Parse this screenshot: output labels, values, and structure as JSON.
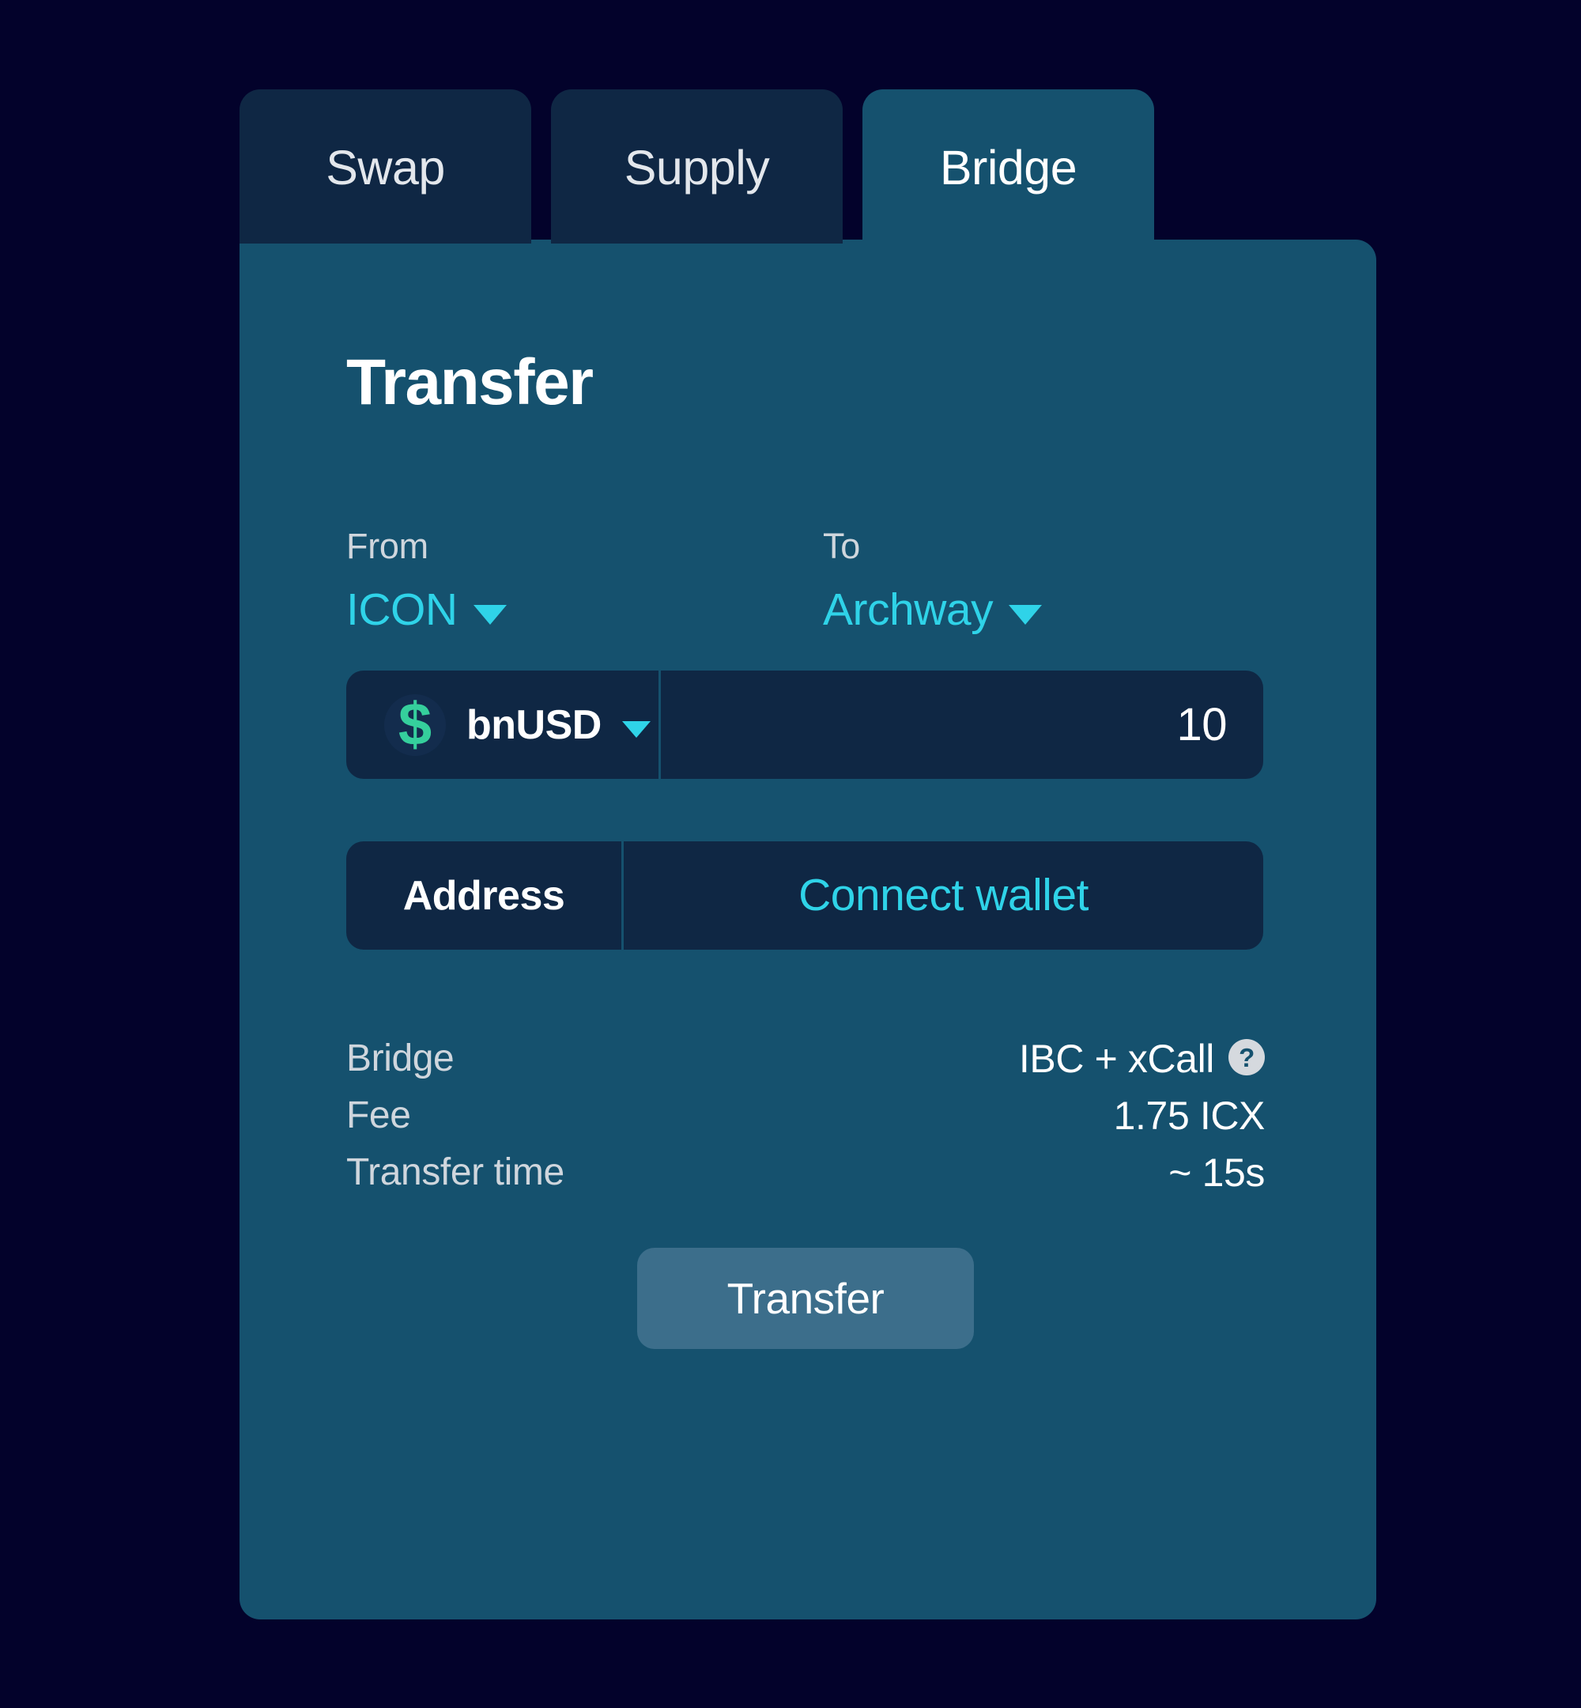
{
  "theme": {
    "page_background": "#03022b",
    "panel_background": "#15516e",
    "tab_inactive_background": "#0f2744",
    "field_background": "#0f2744",
    "accent_cyan": "#2fd3e8",
    "token_green": "#35cf9c",
    "cta_background": "#3c6e8b",
    "muted_text": "#cfd6dd"
  },
  "tabs": [
    {
      "label": "Swap",
      "active": false
    },
    {
      "label": "Supply",
      "active": false
    },
    {
      "label": "Bridge",
      "active": true
    }
  ],
  "panel": {
    "heading": "Transfer",
    "from": {
      "label": "From",
      "chain": "ICON",
      "caret_icon": "chevron-down-icon"
    },
    "to": {
      "label": "To",
      "chain": "Archway",
      "caret_icon": "chevron-down-icon"
    },
    "token_field": {
      "logo_glyph": "$",
      "logo_icon": "bnusd-token-icon",
      "token": "bnUSD",
      "caret_icon": "chevron-down-icon",
      "amount": "10",
      "amount_placeholder": "0"
    },
    "address_field": {
      "label": "Address",
      "connect_label": "Connect wallet",
      "address_placeholder": "Connect wallet"
    },
    "details": [
      {
        "key": "Bridge",
        "value": "IBC + xCall",
        "help_icon": "help-circle-icon"
      },
      {
        "key": "Fee",
        "value": "1.75 ICX"
      },
      {
        "key": "Transfer time",
        "value": "~ 15s"
      }
    ],
    "cta": {
      "label": "Transfer"
    }
  }
}
